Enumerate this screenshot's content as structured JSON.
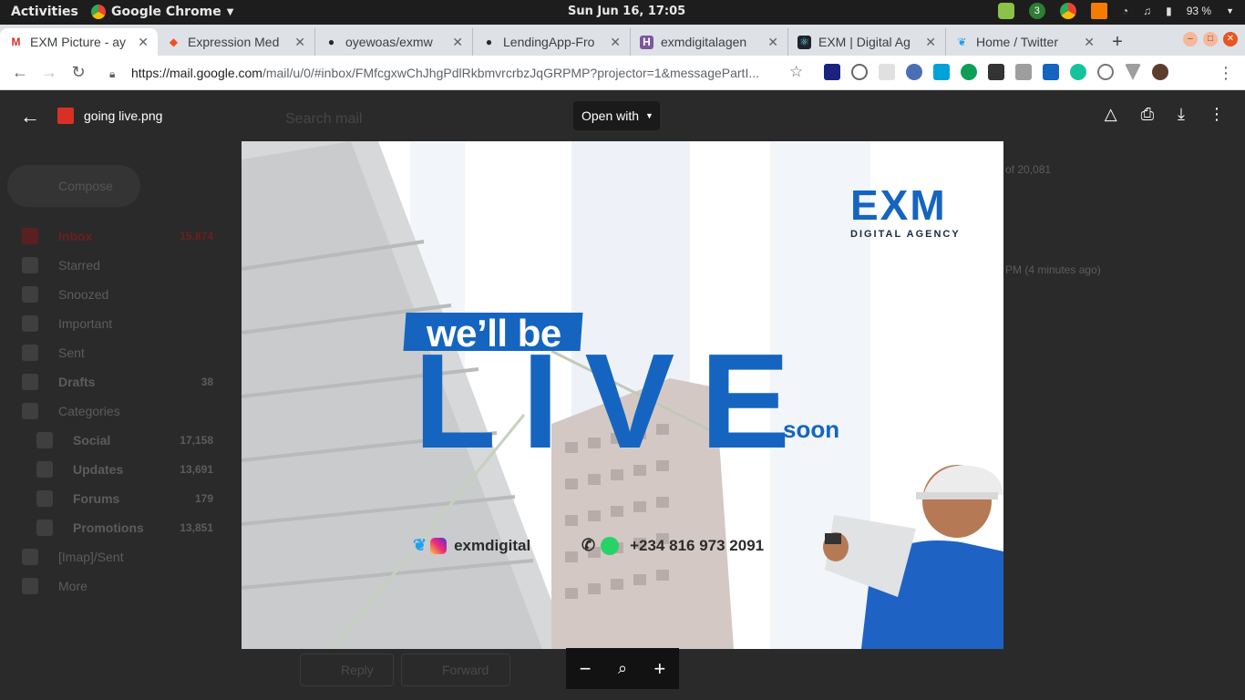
{
  "topbar": {
    "activities": "Activities",
    "app_name": "Google Chrome",
    "clock": "Sun Jun 16, 17:05",
    "battery": "93 %",
    "tray_badge": "3"
  },
  "tabs": [
    {
      "title": "EXM Picture - ay",
      "icon": "gmail-icon",
      "color": "#d93025"
    },
    {
      "title": "Expression Med",
      "icon": "figma-icon",
      "color": "#f24e1e"
    },
    {
      "title": "oyewoas/exmw",
      "icon": "github-icon",
      "color": "#24292e"
    },
    {
      "title": "LendingApp-Fro",
      "icon": "github-icon",
      "color": "#24292e"
    },
    {
      "title": "exmdigitalagen",
      "icon": "heroku-icon",
      "color": "#79589f"
    },
    {
      "title": "EXM | Digital Ag",
      "icon": "react-icon",
      "color": "#20232a"
    },
    {
      "title": "Home / Twitter",
      "icon": "twitter-icon",
      "color": "#1da1f2"
    }
  ],
  "address": {
    "domain": "https://mail.google.com",
    "path": "/mail/u/0/#inbox/FMfcgxwChJhgPdlRkbmvrcrbzJqGRPMP?projector=1&messagePartI..."
  },
  "gmail": {
    "search_placeholder": "Search mail",
    "compose": "Compose",
    "pagination": "of 20,081",
    "time_ago": "PM (4 minutes ago)",
    "folders": [
      {
        "label": "Inbox",
        "count": "15,874"
      },
      {
        "label": "Starred",
        "count": ""
      },
      {
        "label": "Snoozed",
        "count": ""
      },
      {
        "label": "Important",
        "count": ""
      },
      {
        "label": "Sent",
        "count": ""
      },
      {
        "label": "Drafts",
        "count": "38"
      },
      {
        "label": "Categories",
        "count": ""
      },
      {
        "label": "Social",
        "count": "17,158"
      },
      {
        "label": "Updates",
        "count": "13,691"
      },
      {
        "label": "Forums",
        "count": "179"
      },
      {
        "label": "Promotions",
        "count": "13,851"
      },
      {
        "label": "[Imap]/Sent",
        "count": ""
      },
      {
        "label": "More",
        "count": ""
      }
    ],
    "reply": "Reply",
    "forward": "Forward"
  },
  "viewer": {
    "file_name": "going live.png",
    "open_with": "Open with"
  },
  "poster": {
    "logo_mark": "EXM",
    "logo_sub": "DIGITAL AGENCY",
    "headline_1": "we’ll be",
    "headline_2": "LIVE",
    "headline_3": "soon",
    "social_handle": "exmdigital",
    "phone": "+234 816 973 2091",
    "brand_color": "#1565c0"
  }
}
